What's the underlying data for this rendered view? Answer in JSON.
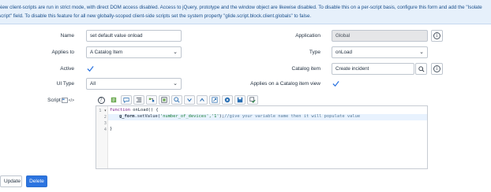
{
  "banner": {
    "line1": "New client-scripts are run in strict mode, with direct DOM access disabled. Access to jQuery, prototype and the window object are likewise disabled. To disable this on a per-script basis, configure this form and add the \"Isolate",
    "line2": "script\" field. To disable this feature for all new globally-scoped client-side scripts set the system property \"glide.script.block.client.globals\" to false."
  },
  "form": {
    "name": {
      "label": "Name",
      "value": "set default value onload"
    },
    "application": {
      "label": "Application",
      "value": "Global"
    },
    "applies_to": {
      "label": "Applies to",
      "value": "A Catalog Item"
    },
    "type": {
      "label": "Type",
      "value": "onLoad"
    },
    "active": {
      "label": "Active",
      "checked": true
    },
    "catalog_item": {
      "label": "Catalog item",
      "value": "Create incident"
    },
    "ui_type": {
      "label": "UI Type",
      "value": "All"
    },
    "applies_on_view": {
      "label": "Applies on a Catalog item view",
      "checked": true
    },
    "script": {
      "label": "Script"
    }
  },
  "editor": {
    "lines": [
      {
        "num": "1",
        "marker": "▾"
      },
      {
        "num": "2",
        "marker": ""
      },
      {
        "num": "3",
        "marker": ""
      },
      {
        "num": "4",
        "marker": ""
      }
    ],
    "code": {
      "line1_kw": "function",
      "line1_rest": " onLoad() {",
      "line2_obj": "g_form",
      "line2_call": ".setValue(",
      "line2_str": "'number_of_devices','1'",
      "line2_end": ");",
      "line2_comment": "//give your variable name then it will populate value",
      "line3": "",
      "line4": "}"
    }
  },
  "toolbar": {
    "icons": [
      "help-icon",
      "toggle-syntax-icon",
      "comment-icon",
      "format-code-icon",
      "replace-icon",
      "toggle-fullscreen-icon",
      "search-icon",
      "script-debugger-icon",
      "collapse-icon",
      "insert-link-icon",
      "run-script-icon",
      "save-script-icon",
      "script-check-icon"
    ]
  },
  "buttons": {
    "update": "Update",
    "delete": "Delete"
  },
  "colors": {
    "banner_bg": "#e6f0fb",
    "primary_button": "#2c74e0",
    "check": "#2c74e0"
  }
}
